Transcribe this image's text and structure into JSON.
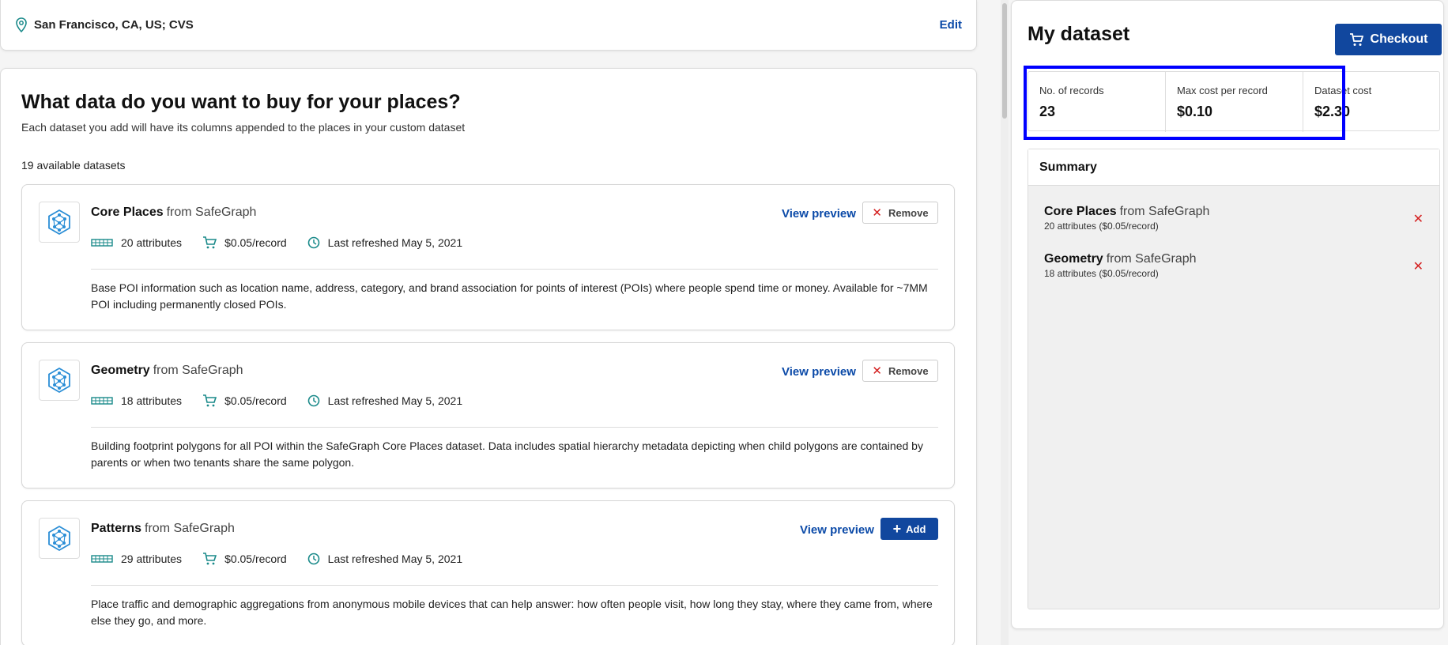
{
  "location": {
    "text": "San Francisco, CA, US; CVS",
    "edit_label": "Edit",
    "icon": "map-pin-icon"
  },
  "main": {
    "title": "What data do you want to buy for your places?",
    "subtitle": "Each dataset you add will have its columns appended to the places in your custom dataset",
    "available_count": "19 available datasets"
  },
  "datasets": [
    {
      "name": "Core Places",
      "source": "from SafeGraph",
      "attributes": "20 attributes",
      "price": "$0.05/record",
      "refreshed": "Last refreshed May 5, 2021",
      "description": "Base POI information such as location name, address, category, and brand association for points of interest (POIs) where people spend time or money. Available for ~7MM POI including permanently closed POIs.",
      "preview_label": "View preview",
      "action_label": "Remove",
      "action_type": "remove"
    },
    {
      "name": "Geometry",
      "source": "from SafeGraph",
      "attributes": "18 attributes",
      "price": "$0.05/record",
      "refreshed": "Last refreshed May 5, 2021",
      "description": "Building footprint polygons for all POI within the SafeGraph Core Places dataset. Data includes spatial hierarchy metadata depicting when child polygons are contained by parents or when two tenants share the same polygon.",
      "preview_label": "View preview",
      "action_label": "Remove",
      "action_type": "remove"
    },
    {
      "name": "Patterns",
      "source": "from SafeGraph",
      "attributes": "29 attributes",
      "price": "$0.05/record",
      "refreshed": "Last refreshed May 5, 2021",
      "description": "Place traffic and demographic aggregations from anonymous mobile devices that can help answer: how often people visit, how long they stay, where they came from, where else they go, and more.",
      "preview_label": "View preview",
      "action_label": "Add",
      "action_type": "add"
    }
  ],
  "my_dataset": {
    "title": "My dataset",
    "checkout_label": "Checkout",
    "stats": [
      {
        "label": "No. of records",
        "value": "23"
      },
      {
        "label": "Max cost per record",
        "value": "$0.10"
      },
      {
        "label": "Dataset cost",
        "value": "$2.30"
      }
    ],
    "summary_title": "Summary",
    "summary_items": [
      {
        "name": "Core Places",
        "source": "from SafeGraph",
        "attrs": "20 attributes ($0.05/record)"
      },
      {
        "name": "Geometry",
        "source": "from SafeGraph",
        "attrs": "18 attributes ($0.05/record)"
      }
    ]
  },
  "colors": {
    "accent": "#11479e",
    "link": "#0b4aa8",
    "remove": "#d42020",
    "highlight": "#0000ff",
    "teal": "#1a8a8a"
  }
}
